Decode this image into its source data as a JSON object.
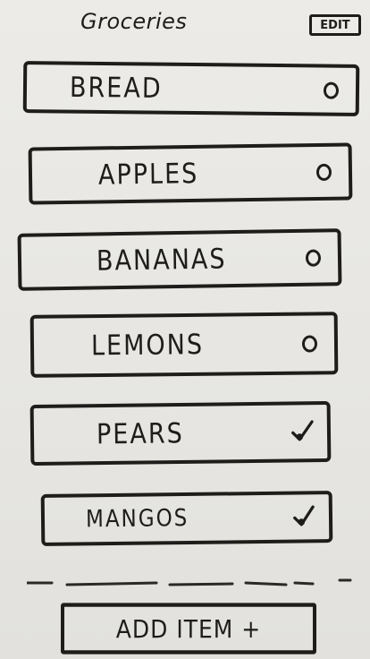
{
  "header": {
    "title": "Groceries",
    "edit_label": "EDIT"
  },
  "items": [
    {
      "label": "BREAD",
      "status": "circle"
    },
    {
      "label": "APPLES",
      "status": "circle"
    },
    {
      "label": "BANANAS",
      "status": "circle"
    },
    {
      "label": "LEMONS",
      "status": "circle"
    },
    {
      "label": "PEARS",
      "status": "check"
    },
    {
      "label": "MANGOS",
      "status": "check"
    }
  ],
  "footer": {
    "add_label": "ADD ITEM +"
  }
}
